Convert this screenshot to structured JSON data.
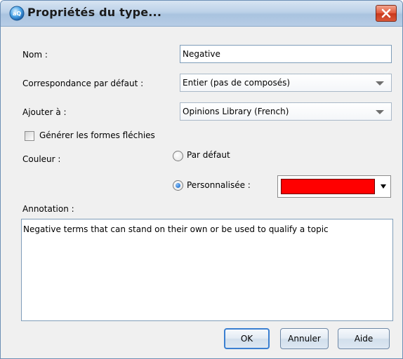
{
  "dialog": {
    "title": "Propriétés du type...",
    "icon": "app-icon",
    "close_icon": "close-icon"
  },
  "form": {
    "name_label": "Nom :",
    "name_value": "Negative",
    "match_label": "Correspondance par défaut :",
    "match_value": "Entier (pas de composés)",
    "add_to_label": "Ajouter à :",
    "add_to_value": "Opinions Library (French)",
    "inflected_label": "Générer les formes fléchies",
    "inflected_checked": false,
    "color_label": "Couleur :",
    "color_default_label": "Par défaut",
    "color_custom_label": "Personnalisée :",
    "color_selected": "custom",
    "custom_color": "#ff0000",
    "annotation_label": "Annotation :",
    "annotation_value": "Negative terms that can stand on their own or be used to qualify a topic"
  },
  "buttons": {
    "ok": "OK",
    "cancel": "Annuler",
    "help": "Aide"
  }
}
